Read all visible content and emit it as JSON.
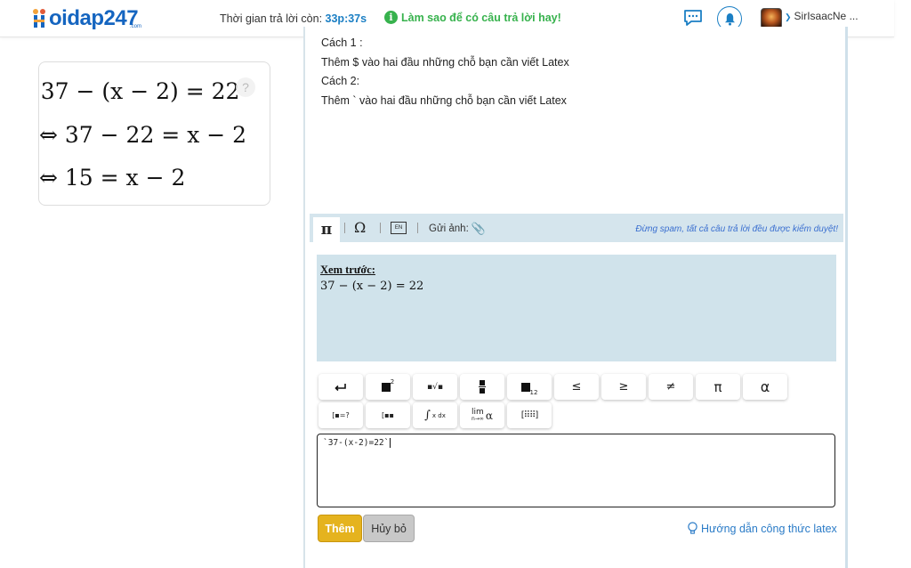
{
  "header": {
    "logo_text": "oidap247",
    "logo_sub": ".com",
    "timer_label": "Thời gian trả lời còn: ",
    "timer_value": "33p:37s",
    "howto_label": "Làm sao để có câu trả lời hay!",
    "username": "SirIsaacNe ..."
  },
  "math_card": {
    "line1": ")37 − (x − 2) = 22",
    "line2": "⇔ 37 − 22 = x − 2",
    "line3": "⇔ 15 = x − 2",
    "help_glyph": "?"
  },
  "guide": {
    "line1": "Cách 1 :",
    "line2": "Thêm $ vào hai đầu những chỗ bạn cần viết Latex",
    "line3": "Cách 2:",
    "line4": "Thêm ` vào hai đầu những chỗ bạn cần viết Latex"
  },
  "toolbar": {
    "tab_pi": "π",
    "tab_omega": "Ω",
    "tab_en": "EN",
    "image_label": "Gửi ảnh:",
    "warning": "Đừng spam, tất cả câu trả lời đều được kiểm duyệt!"
  },
  "preview": {
    "label": "Xem trước:",
    "math": "37 − (x − 2) = 22"
  },
  "symbols": {
    "le": "≤",
    "ge": "≥",
    "ne": "≠",
    "pi": "π",
    "alpha": "α",
    "integral_label": "x dx",
    "lim_label": "lim",
    "lim_sub": "n→∞",
    "lim_var": "α",
    "exp": "2",
    "sub": "12"
  },
  "editor": {
    "value": "`37-(x-2)=22`"
  },
  "actions": {
    "add_label": "Thêm",
    "cancel_label": "Hủy bỏ",
    "latex_help": "Hướng dẫn công thức latex"
  }
}
